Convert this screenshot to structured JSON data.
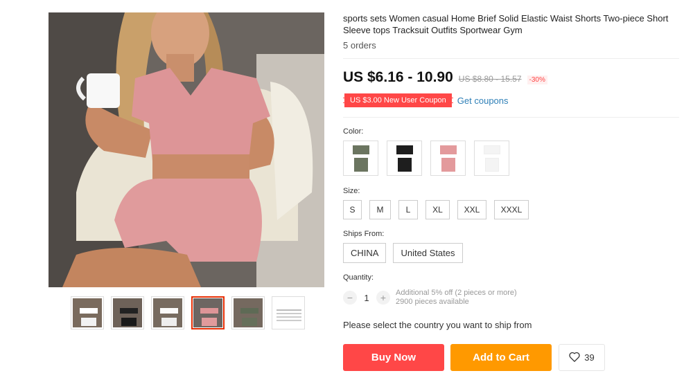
{
  "product": {
    "title": "sports sets Women casual Home Brief Solid Elastic Waist Shorts Two-piece Short Sleeve tops Tracksuit Outfits Sportwear Gym",
    "orders": "5 orders"
  },
  "price": {
    "current": "US $6.16 - 10.90",
    "original": "US $8.80 - 15.57",
    "discount": "-30%"
  },
  "coupon": {
    "badge": "US $3.00 New User Coupon",
    "link": "Get coupons"
  },
  "color": {
    "label": "Color:",
    "swatches": [
      {
        "name": "olive",
        "color": "#6b7560"
      },
      {
        "name": "black",
        "color": "#1e1e1e"
      },
      {
        "name": "pink",
        "color": "#e39a9c"
      },
      {
        "name": "white",
        "color": "#f4f4f4"
      }
    ]
  },
  "size": {
    "label": "Size:",
    "options": [
      "S",
      "M",
      "L",
      "XL",
      "XXL",
      "XXXL"
    ]
  },
  "ships_from": {
    "label": "Ships From:",
    "options": [
      "CHINA",
      "United States"
    ]
  },
  "quantity": {
    "label": "Quantity:",
    "value": "1",
    "minus": "−",
    "plus": "+",
    "note1": "Additional 5% off (2 pieces or more)",
    "note2": "2900 pieces available"
  },
  "ship_message": "Please select the country you want to ship from",
  "actions": {
    "buy_now": "Buy Now",
    "add_to_cart": "Add to Cart",
    "wishlist_count": "39"
  },
  "icons": {
    "wishlist": "heart-icon"
  }
}
